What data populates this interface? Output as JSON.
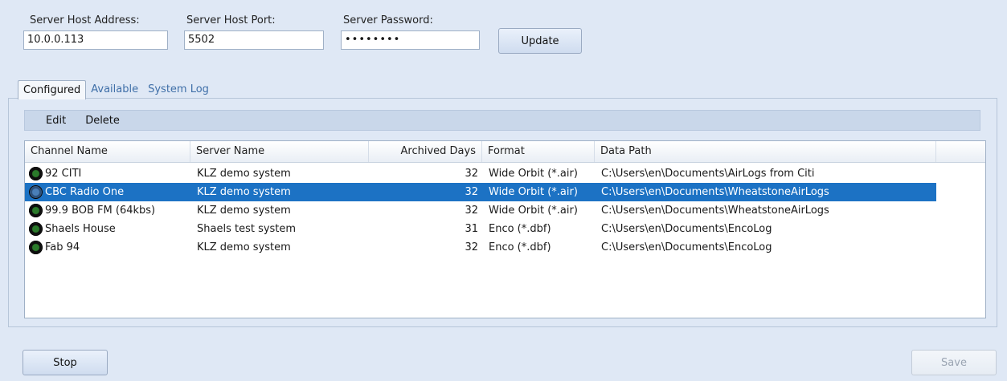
{
  "server": {
    "host_label": "Server Host Address:",
    "host_value": "10.0.0.113",
    "port_label": "Server Host Port:",
    "port_value": "5502",
    "password_label": "Server Password:",
    "password_value": "••••••••",
    "update_label": "Update"
  },
  "tabs": [
    {
      "label": "Configured",
      "active": true
    },
    {
      "label": "Available",
      "active": false
    },
    {
      "label": "System Log",
      "active": false
    }
  ],
  "toolbar": {
    "edit_label": "Edit",
    "delete_label": "Delete"
  },
  "grid": {
    "columns": [
      "Channel Name",
      "Server Name",
      "Archived Days",
      "Format",
      "Data Path"
    ],
    "rows": [
      {
        "channel": "92 CITI",
        "server": "KLZ demo system",
        "days": "32",
        "format": "Wide Orbit (*.air)",
        "path": "C:\\Users\\en\\Documents\\AirLogs from Citi",
        "selected": false
      },
      {
        "channel": "CBC Radio One",
        "server": "KLZ demo system",
        "days": "32",
        "format": "Wide Orbit (*.air)",
        "path": "C:\\Users\\en\\Documents\\WheatstoneAirLogs",
        "selected": true
      },
      {
        "channel": "99.9 BOB FM (64kbs)",
        "server": "KLZ demo system",
        "days": "32",
        "format": "Wide Orbit (*.air)",
        "path": "C:\\Users\\en\\Documents\\WheatstoneAirLogs",
        "selected": false
      },
      {
        "channel": "Shaels House",
        "server": "Shaels test system",
        "days": "31",
        "format": "Enco (*.dbf)",
        "path": "C:\\Users\\en\\Documents\\EncoLog",
        "selected": false
      },
      {
        "channel": "Fab 94",
        "server": "KLZ demo system",
        "days": "32",
        "format": "Enco (*.dbf)",
        "path": "C:\\Users\\en\\Documents\\EncoLog",
        "selected": false
      }
    ]
  },
  "footer": {
    "stop_label": "Stop",
    "save_label": "Save"
  },
  "colors": {
    "background": "#dfe8f5",
    "selection": "#1c72c4",
    "tab_link": "#3f6fa8"
  },
  "icons": {
    "channel_status": "channel-status-icon"
  }
}
